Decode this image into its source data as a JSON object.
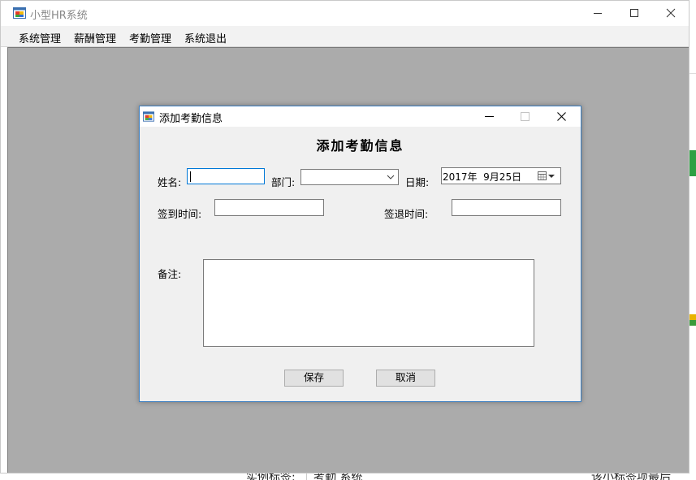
{
  "app": {
    "title": "小型HR系统",
    "icon": "app-window-icon",
    "window_controls": [
      "minimize-icon",
      "maximize-icon",
      "close-icon"
    ]
  },
  "menubar": {
    "items": [
      {
        "label": "系统管理"
      },
      {
        "label": "薪酬管理"
      },
      {
        "label": "考勤管理"
      },
      {
        "label": "系统退出"
      }
    ]
  },
  "dialog": {
    "title": "添加考勤信息",
    "heading": "添加考勤信息",
    "form": {
      "name_label": "姓名:",
      "name_value": "",
      "dept_label": "部门:",
      "dept_value": "",
      "date_label": "日期:",
      "date_value": "2017年  9月25日",
      "checkin_label": "签到时间:",
      "checkin_value": "",
      "checkout_label": "签退时间:",
      "checkout_value": "",
      "notes_label": "备注:",
      "notes_value": ""
    },
    "buttons": {
      "save": "保存",
      "cancel": "取消"
    }
  },
  "background": {
    "bottom_texts": [
      "实例标签:",
      "考勤 系统",
      "该小标签项最后"
    ]
  },
  "colors": {
    "mdi_background": "#ababab",
    "dialog_border": "#3c7fc1",
    "focus_border": "#0078d7"
  }
}
